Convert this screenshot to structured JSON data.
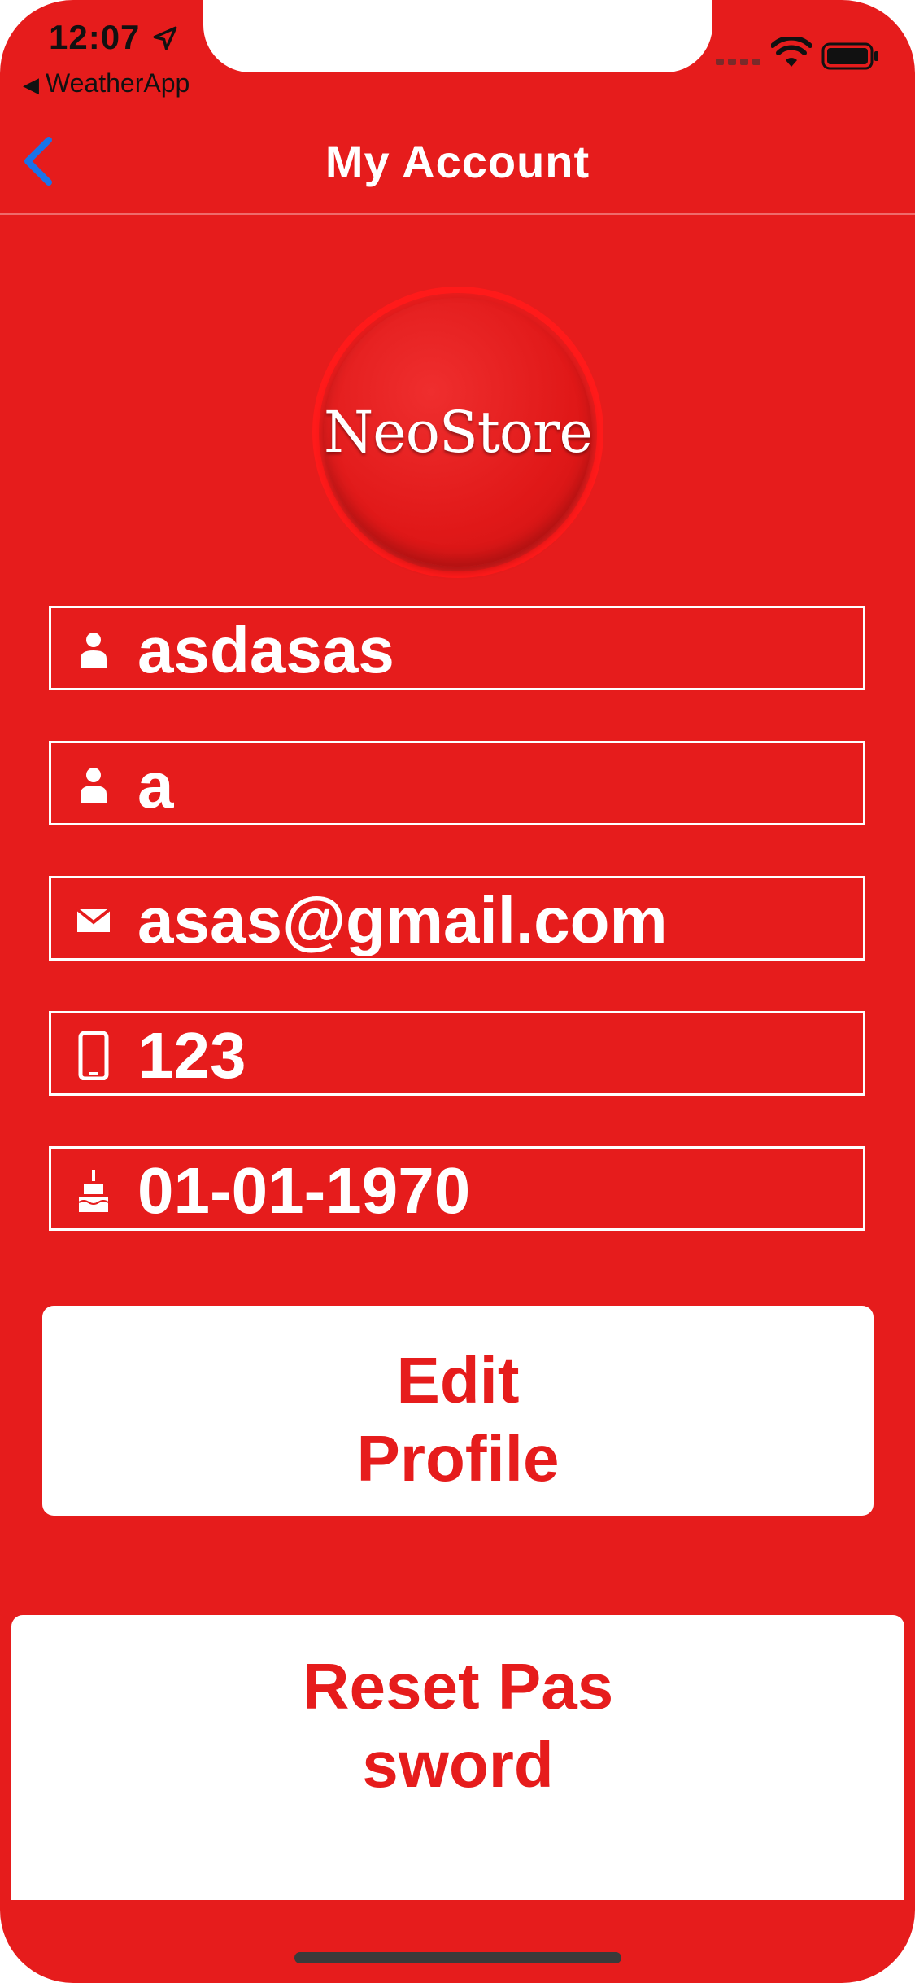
{
  "status_bar": {
    "time": "12:07",
    "back_app": "WeatherApp"
  },
  "nav": {
    "title": "My Account"
  },
  "logo": {
    "text": "NeoStore"
  },
  "fields": [
    {
      "icon": "user-icon",
      "value": "asdasas"
    },
    {
      "icon": "user-icon",
      "value": "a"
    },
    {
      "icon": "mail-icon",
      "value": "asas@gmail.com"
    },
    {
      "icon": "phone-icon",
      "value": "123"
    },
    {
      "icon": "cake-icon",
      "value": "01-01-1970"
    }
  ],
  "buttons": {
    "edit_profile": "Edit Profile",
    "reset_password": "Reset Password"
  },
  "colors": {
    "background": "#e61c1c",
    "accent_blue": "#1a73e8",
    "button_bg": "#ffffff",
    "button_text": "#e61c1c"
  }
}
